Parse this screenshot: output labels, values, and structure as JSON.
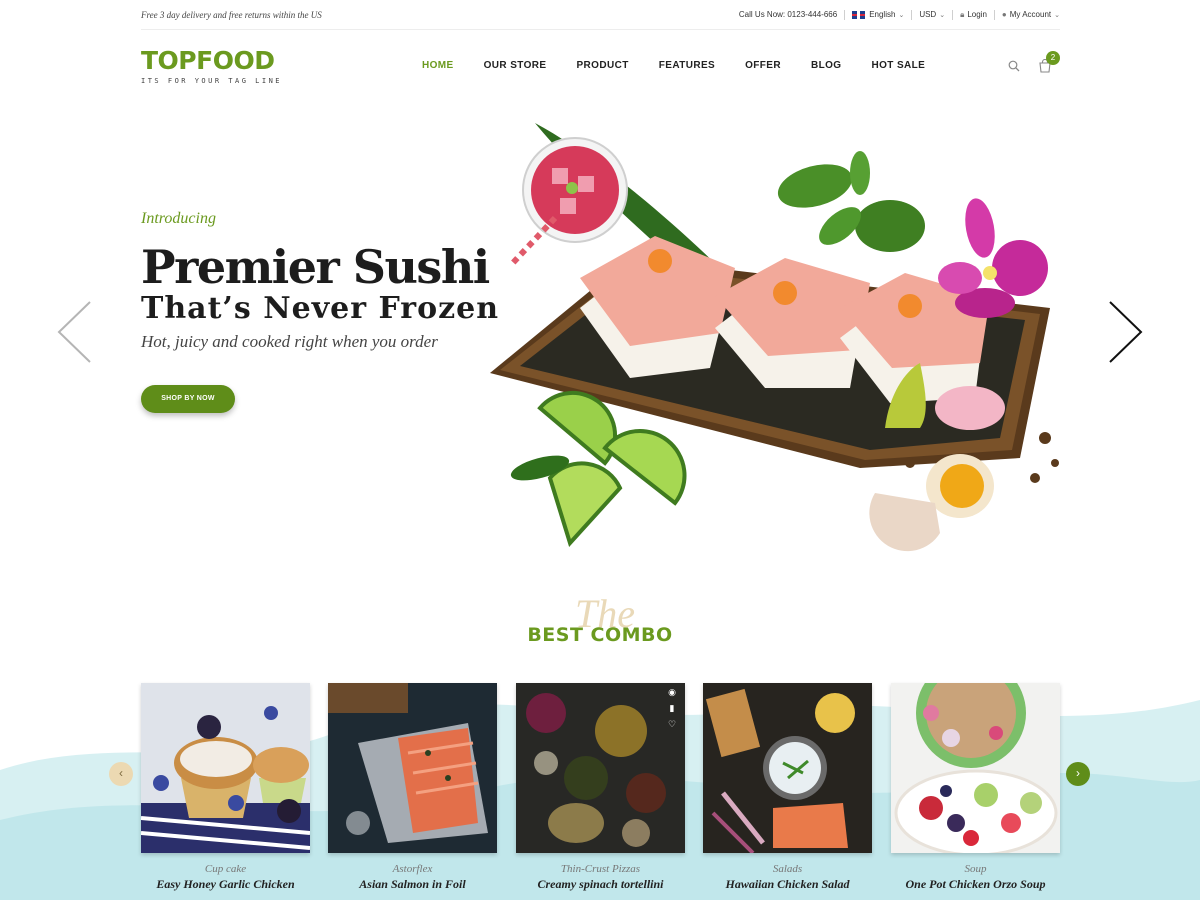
{
  "topbar": {
    "promo": "Free 3 day delivery and free returns within the US",
    "call": "Call Us Now: 0123-444-666",
    "language": "English",
    "currency": "USD",
    "login": "Login",
    "account": "My Account"
  },
  "logo": {
    "name": "TOPFOOD",
    "tagline": "ITS FOR YOUR TAG LINE"
  },
  "nav": [
    "HOME",
    "OUR STORE",
    "PRODUCT",
    "FEATURES",
    "OFFER",
    "BLOG",
    "HOT SALE"
  ],
  "cart": {
    "count": "2"
  },
  "hero": {
    "intro": "Introducing",
    "title": "Premier Sushi",
    "subtitle": "That’s Never Frozen",
    "tagline": "Hot, juicy and cooked right when you order",
    "button": "SHOP BY NOW"
  },
  "combo": {
    "script": "The",
    "title": "BEST COMBO",
    "items": [
      {
        "category": "Cup cake",
        "name": "Easy Honey Garlic Chicken"
      },
      {
        "category": "Astorflex",
        "name": "Asian Salmon in Foil"
      },
      {
        "category": "Thin-Crust Pizzas",
        "name": "Creamy spinach tortellini"
      },
      {
        "category": "Salads",
        "name": "Hawaiian Chicken Salad"
      },
      {
        "category": "Soup",
        "name": "One Pot Chicken Orzo Soup"
      }
    ]
  },
  "colors": {
    "accent": "#6b9a1f",
    "button": "#5f8d19",
    "wash": "#bfe6ea"
  },
  "icons": [
    "search-icon",
    "cart-icon",
    "chevron-left-icon",
    "chevron-right-icon",
    "eye-icon",
    "chart-icon",
    "heart-icon",
    "user-icon",
    "lock-icon"
  ]
}
